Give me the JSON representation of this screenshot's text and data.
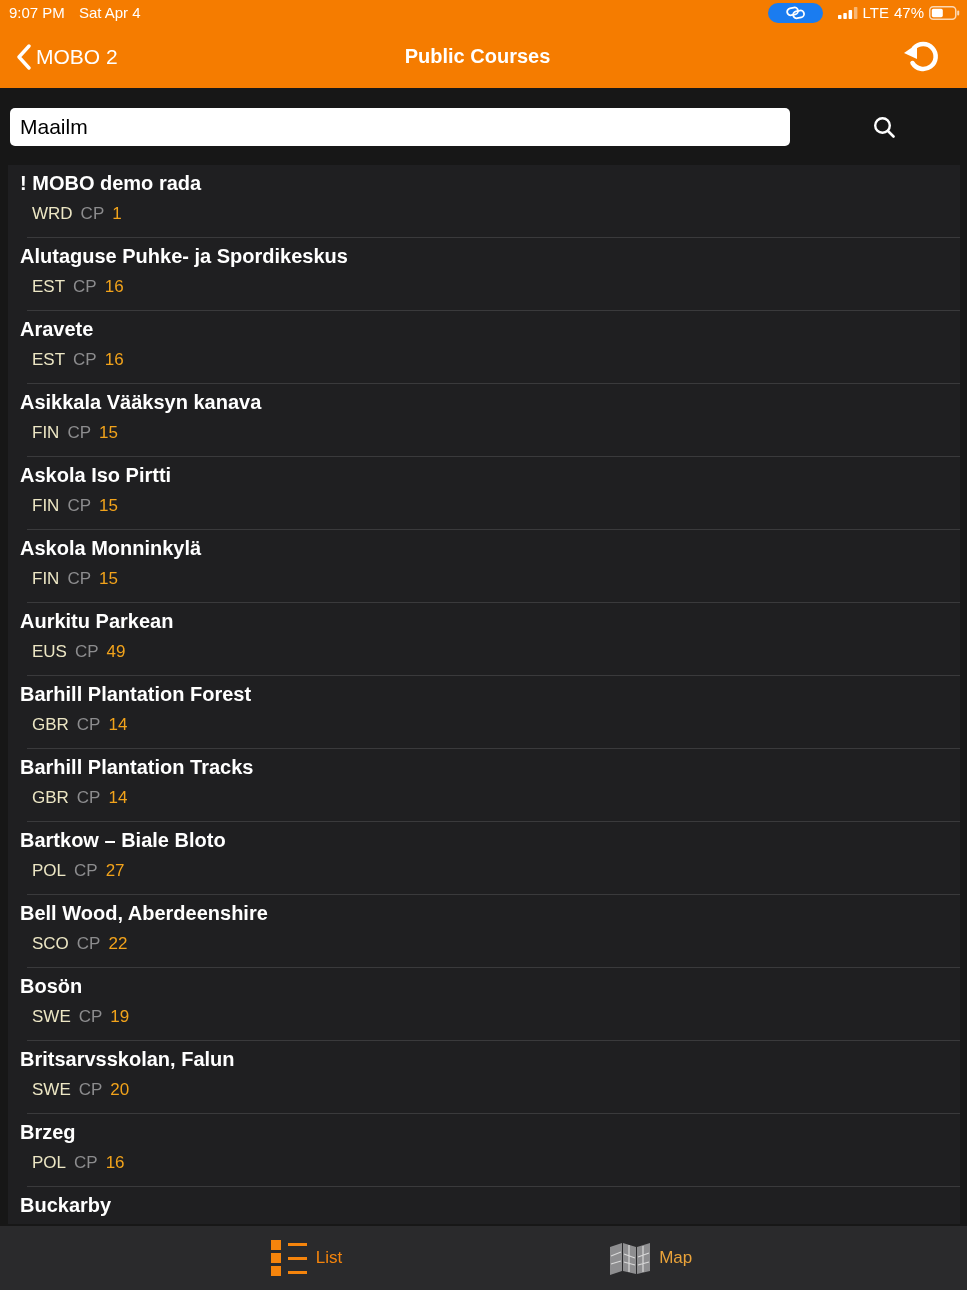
{
  "status_bar": {
    "time": "9:07 PM",
    "date": "Sat Apr 4",
    "network": "LTE",
    "battery": "47%"
  },
  "nav_bar": {
    "back_label": "MOBO 2",
    "title": "Public Courses"
  },
  "search": {
    "value": "Maailm"
  },
  "courses": [
    {
      "name": "! MOBO demo rada",
      "country": "WRD",
      "cp_label": "CP",
      "count": "1"
    },
    {
      "name": "Alutaguse Puhke- ja Spordikeskus",
      "country": "EST",
      "cp_label": "CP",
      "count": "16"
    },
    {
      "name": "Aravete",
      "country": "EST",
      "cp_label": "CP",
      "count": "16"
    },
    {
      "name": "Asikkala Vääksyn kanava",
      "country": "FIN",
      "cp_label": "CP",
      "count": "15"
    },
    {
      "name": "Askola Iso Pirtti",
      "country": "FIN",
      "cp_label": "CP",
      "count": "15"
    },
    {
      "name": "Askola Monninkylä",
      "country": "FIN",
      "cp_label": "CP",
      "count": "15"
    },
    {
      "name": "Aurkitu Parkean",
      "country": "EUS",
      "cp_label": "CP",
      "count": "49"
    },
    {
      "name": "Barhill Plantation Forest",
      "country": "GBR",
      "cp_label": "CP",
      "count": "14"
    },
    {
      "name": "Barhill Plantation Tracks",
      "country": "GBR",
      "cp_label": "CP",
      "count": "14"
    },
    {
      "name": "Bartkow – Biale Bloto",
      "country": "POL",
      "cp_label": "CP",
      "count": "27"
    },
    {
      "name": "Bell Wood, Aberdeenshire",
      "country": "SCO",
      "cp_label": "CP",
      "count": "22"
    },
    {
      "name": "Bosön",
      "country": "SWE",
      "cp_label": "CP",
      "count": "19"
    },
    {
      "name": "Britsarvsskolan, Falun",
      "country": "SWE",
      "cp_label": "CP",
      "count": "20"
    },
    {
      "name": "Brzeg",
      "country": "POL",
      "cp_label": "CP",
      "count": "16"
    },
    {
      "name": "Buckarby"
    }
  ],
  "tabs": [
    {
      "kind": "list",
      "label": "List",
      "selected": true
    },
    {
      "kind": "map",
      "label": "Map",
      "selected": false
    }
  ]
}
